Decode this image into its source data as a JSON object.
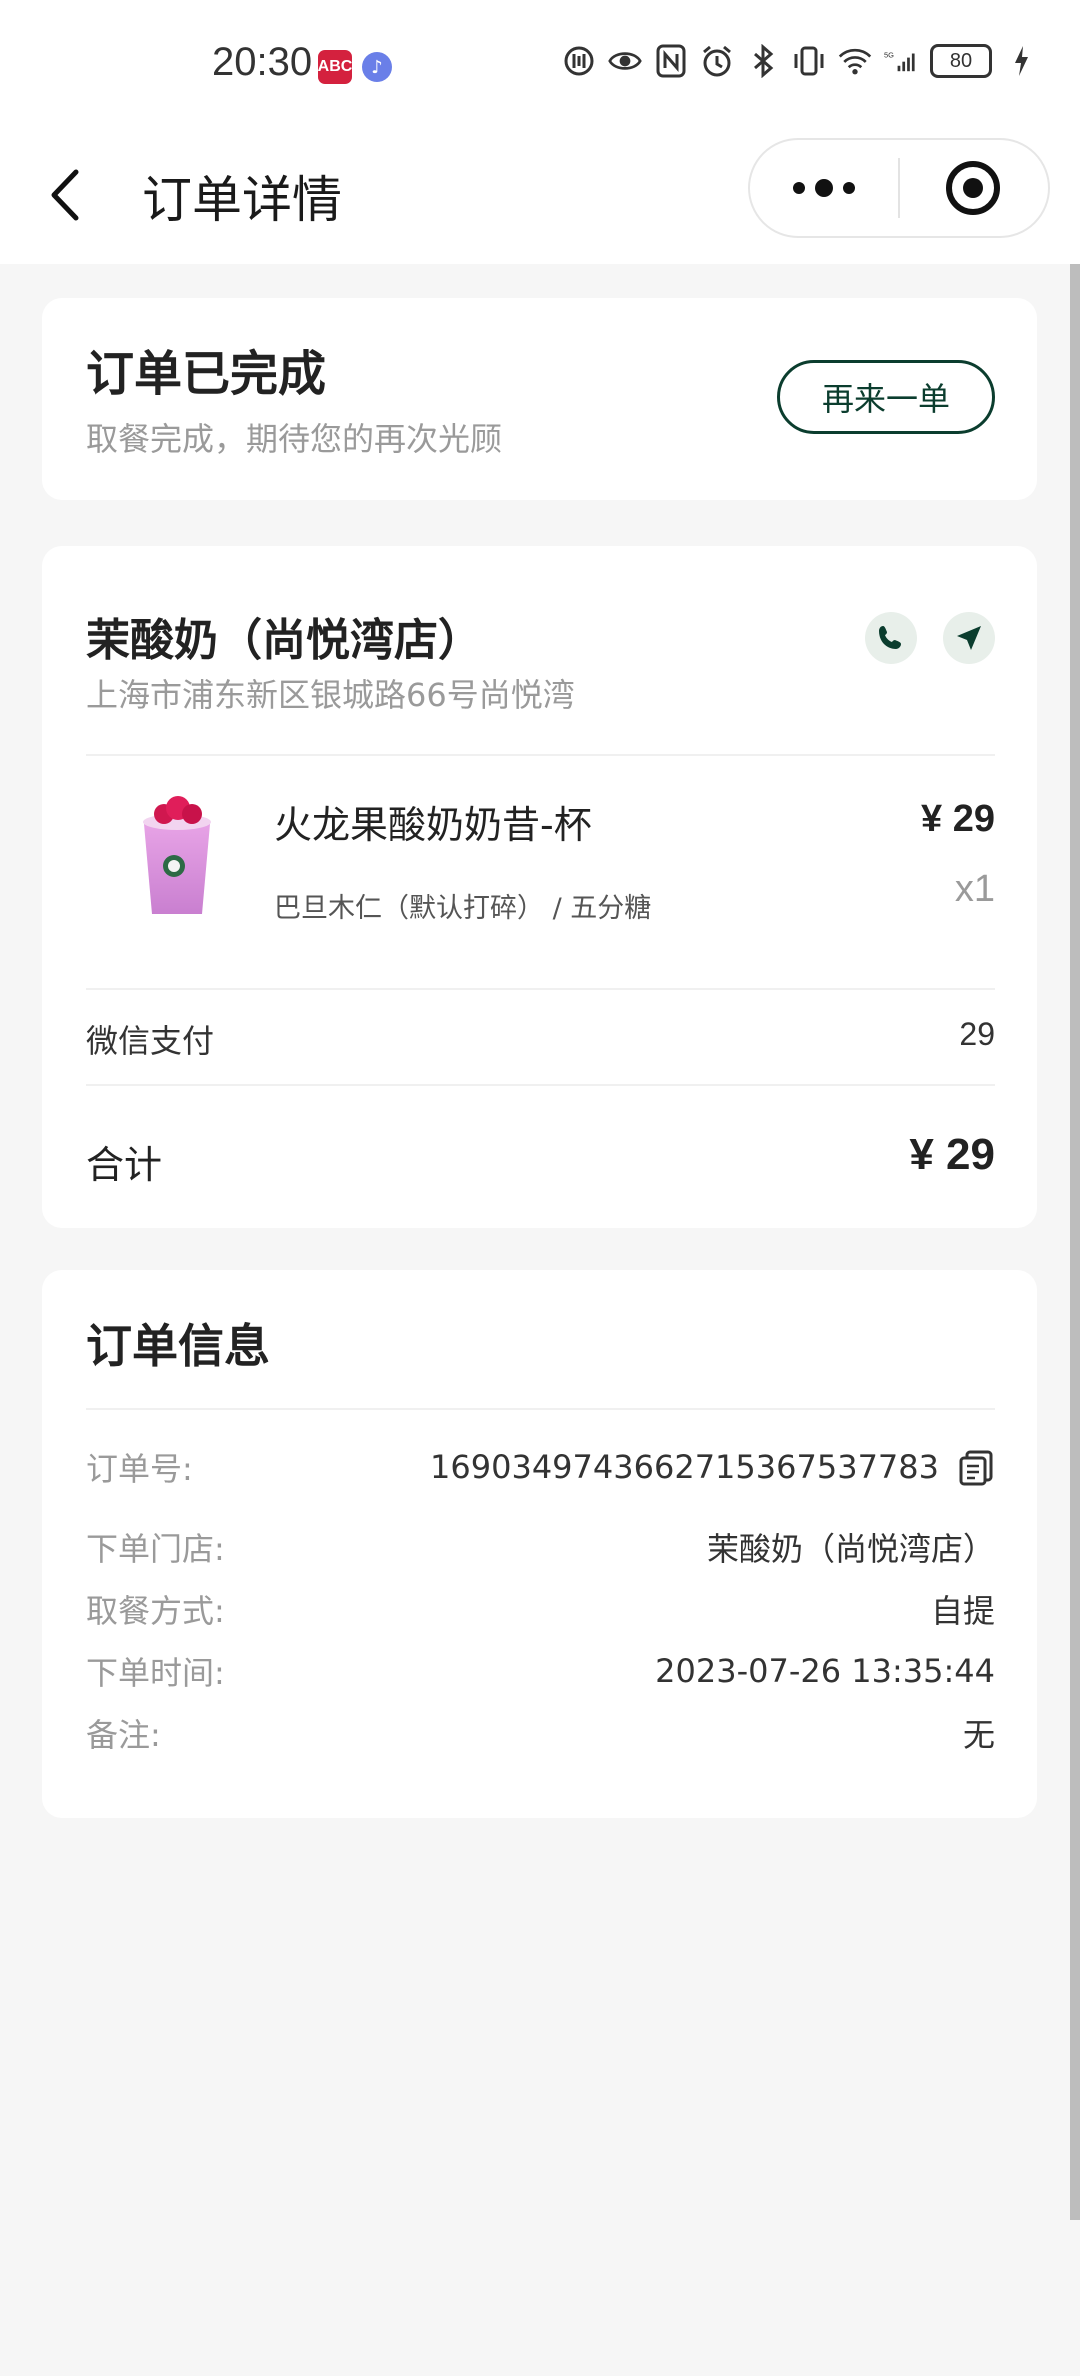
{
  "status_bar": {
    "time": "20:30",
    "app1_icon": "bank-app-icon",
    "app2_icon": "music-app-icon",
    "battery": "80",
    "icons": [
      "data-saver-icon",
      "eye-icon",
      "nfc-icon",
      "alarm-icon",
      "bluetooth-icon",
      "vibrate-icon",
      "wifi-icon",
      "5g-signal-icon",
      "charging-icon"
    ]
  },
  "nav": {
    "title": "订单详情"
  },
  "order_status": {
    "title": "订单已完成",
    "subtitle": "取餐完成，期待您的再次光顾",
    "reorder_label": "再来一单"
  },
  "store": {
    "name": "茉酸奶（尚悦湾店）",
    "address": "上海市浦东新区银城路66号尚悦湾"
  },
  "product": {
    "name": "火龙果酸奶奶昔-杯",
    "options": "巴旦木仁（默认打碎） / 五分糖",
    "price": "¥ 29",
    "qty": "x1"
  },
  "payment": {
    "method_label": "微信支付",
    "method_value": "29",
    "total_label": "合计",
    "total_value": "¥ 29"
  },
  "order_info": {
    "title": "订单信息",
    "rows": [
      {
        "label": "订单号:",
        "value": "1690349743662715367537783"
      },
      {
        "label": "下单门店:",
        "value": "茉酸奶（尚悦湾店）"
      },
      {
        "label": "取餐方式:",
        "value": "自提"
      },
      {
        "label": "下单时间:",
        "value": "2023-07-26 13:35:44"
      },
      {
        "label": "备注:",
        "value": "无"
      }
    ]
  },
  "colors": {
    "brand_green": "#0b3d2e",
    "background": "#f6f6f6"
  }
}
